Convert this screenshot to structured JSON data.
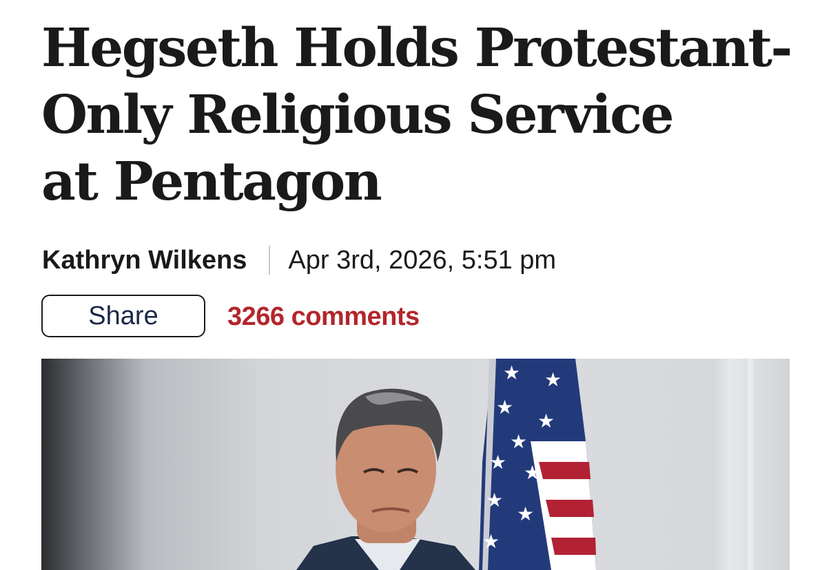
{
  "article": {
    "headline_lines": [
      "Hegseth Holds Protestant-",
      "Only Religious Service",
      "at Pentagon"
    ],
    "author": "Kathryn Wilkens",
    "date": "Apr 3rd, 2026, 5:51 pm",
    "share_label": "Share",
    "comments_label": "3266 comments"
  },
  "colors": {
    "comments": "#b3262c",
    "text": "#1a1a1a",
    "share_text": "#1a2748"
  }
}
